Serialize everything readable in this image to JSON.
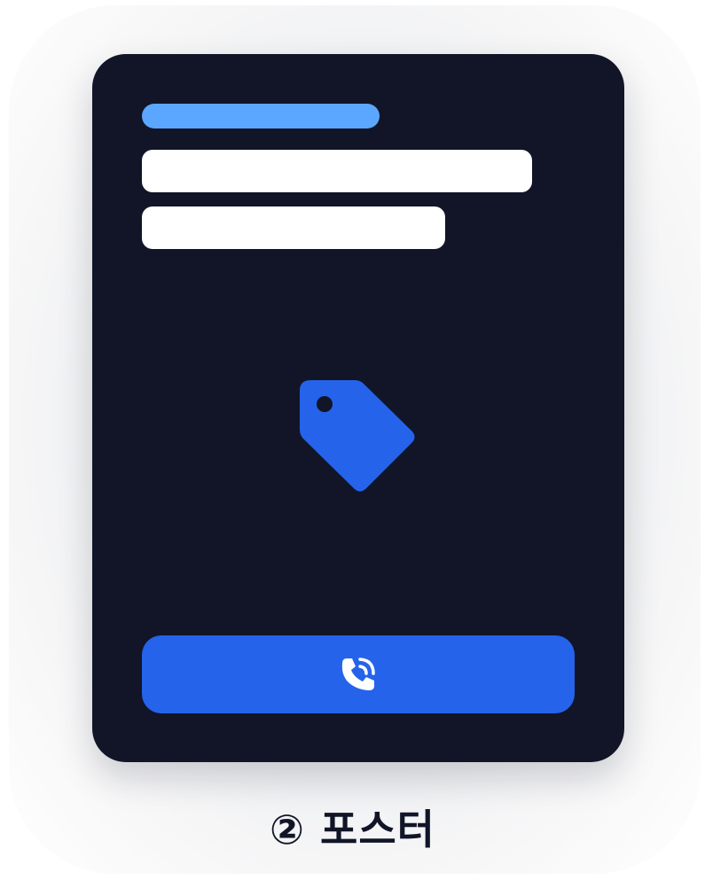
{
  "poster": {
    "caption": "② 포스터",
    "icons": {
      "center": "tag-icon",
      "button": "phone-call-icon"
    }
  },
  "colors": {
    "card_background": "#111527",
    "accent_bar": "#5ba7ff",
    "text_placeholder": "#ffffff",
    "primary": "#2563eb",
    "caption": "#111527"
  }
}
